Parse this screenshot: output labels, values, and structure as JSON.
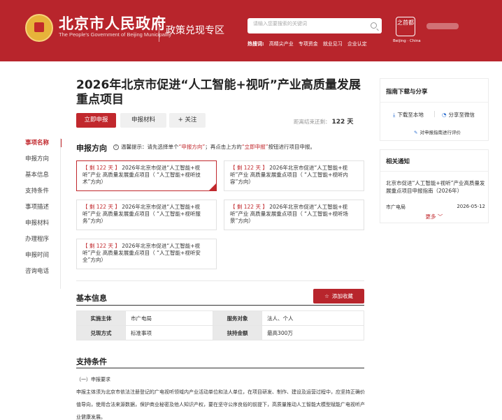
{
  "header": {
    "site_title": "北京市人民政府",
    "site_subtitle": "The People's Government of Beijing Municipality",
    "zone_name": "政策兑现专区",
    "search_placeholder": "请输入您要搜索的关键词",
    "hot_label": "热搜词:",
    "hot_words": [
      "高精尖产业",
      "专项资金",
      "就业见习",
      "企业认定"
    ],
    "capital_logo": "之首都",
    "capital_caption": "Beijing · China"
  },
  "project": {
    "title": "2026年北京市促进“人工智能+视听”产业高质量发展重点项目",
    "apply_label": "立即申报",
    "materials_label": "申报材料",
    "follow_label": "+ 关注",
    "deadline_prefix": "距离结束还剩：",
    "deadline_value": "122 天"
  },
  "left_nav": {
    "items": [
      "事项名称",
      "申报方向",
      "基本信息",
      "支持条件",
      "事项描述",
      "申报材料",
      "办理程序",
      "申报时间",
      "咨询电话"
    ]
  },
  "direction": {
    "title": "申报方向",
    "tip_prefix": "温馨提示：请先选择单个",
    "tip_hl1": "“申报方向”",
    "tip_middle": "；再点击上方的",
    "tip_hl2": "“立即申报”",
    "tip_suffix": "按钮进行项目申报。",
    "cards": [
      {
        "days": "【 剩 122 天 】",
        "text": "2026年北京市促进“人工智能+视听”产业 高质量发展重点项目（ “人工智能+视听技术”方向）"
      },
      {
        "days": "【 剩 122 天 】",
        "text": "2026年北京市促进“人工智能+视听”产业 高质量发展重点项目（ “人工智能+视听内容”方向）"
      },
      {
        "days": "【 剩 122 天 】",
        "text": "2026年北京市促进“人工智能+视听”产业 高质量发展重点项目（ “人工智能+视听服务”方向）"
      },
      {
        "days": "【 剩 122 天 】",
        "text": "2026年北京市促进“人工智能+视听”产业 高质量发展重点项目（ “人工智能+视听场景”方向）"
      },
      {
        "days": "【 剩 122 天 】",
        "text": "2026年北京市促进“人工智能+视听”产业 高质量发展重点项目（ “人工智能+视听安全”方向）"
      }
    ]
  },
  "basic_info": {
    "title": "基本信息",
    "collect_label": "添加收藏",
    "rows": [
      {
        "k1": "实施主体",
        "v1": "市广电局",
        "k2": "服务对象",
        "v2": "法人、个人"
      },
      {
        "k1": "兑现方式",
        "v1": "标准事项",
        "k2": "扶持金额",
        "v2": "最高300万"
      }
    ]
  },
  "support": {
    "title": "支持条件",
    "subheading": "（一）申报要求",
    "paragraph": "申报主体须为北京市依法注册登记的广电视听领域内产业活动单位和法人单位，在项目研发、制作、建设及运营过程中，应坚持正确价值导向，使用合法来源数据，保护商业秘密及他人知识产权，要在坚守公序良俗的前提下，高质量推动人工智能大模型赋能广电视听产业健康发展。"
  },
  "guide_panel": {
    "title": "指南下载与分享",
    "download_label": "下载至本地",
    "share_label": "分享至微信",
    "eval_label": "对申报指南进行评价"
  },
  "notice_panel": {
    "title": "相关通知",
    "item_title": "北京市促进“人工智能+视听”产业高质量发展重点项目申报指南（2026年）",
    "item_source": "市广电局",
    "item_date": "2026-05-12",
    "more_label": "更多 ﹀"
  },
  "colors": {
    "brand_red": "#b8252c",
    "accent_red": "#c1282d",
    "link_blue": "#2c6fd1"
  }
}
